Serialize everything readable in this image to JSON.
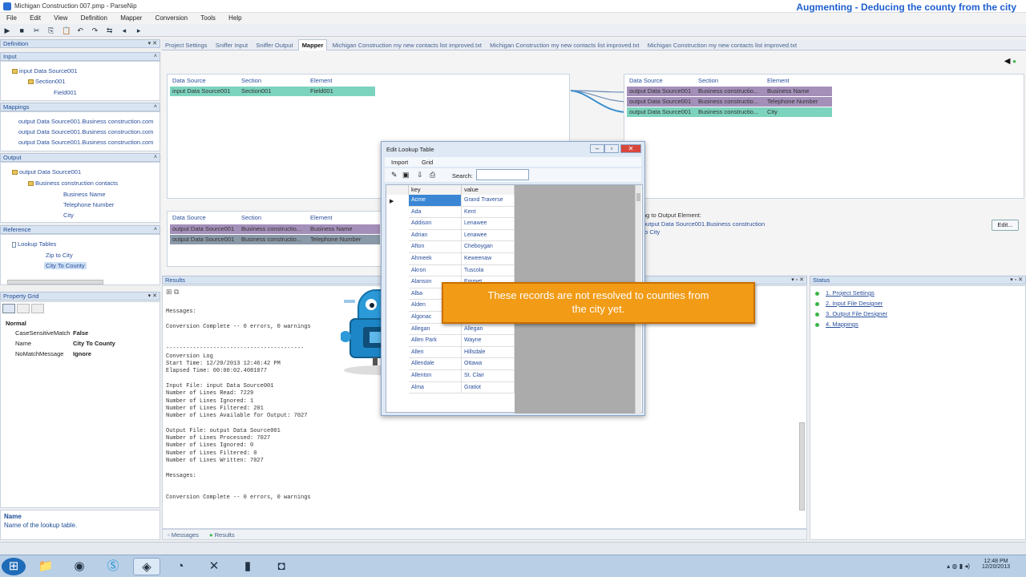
{
  "window": {
    "title": "Michigan Construction 007.pmp - ParseNip"
  },
  "overlay_title": "Augmenting - Deducing the county from the city",
  "menu": [
    "File",
    "Edit",
    "View",
    "Definition",
    "Mapper",
    "Conversion",
    "Tools",
    "Help"
  ],
  "left": {
    "definition_label": "Definition",
    "input_label": "Input",
    "input_tree": [
      "input Data Source001",
      "Section001",
      "Field001"
    ],
    "mappings_label": "Mappings",
    "mappings": [
      "output Data Source001.Business construction.com",
      "output Data Source001.Business construction.com",
      "output Data Source001.Business construction.com"
    ],
    "output_label": "Output",
    "output_tree": [
      "output Data Source001",
      "Business construction contacts",
      "Business Name",
      "Telephone Number",
      "City"
    ],
    "reference_label": "Reference",
    "reference_tree": [
      "Lookup Tables",
      "Zip to City",
      "City To County"
    ],
    "property_grid_label": "Property Grid",
    "props": {
      "category": "Normal",
      "rows": [
        {
          "k": "CaseSensitiveMatch",
          "v": "False"
        },
        {
          "k": "Name",
          "v": "City To County"
        },
        {
          "k": "NoMatchMessage",
          "v": "Ignore"
        }
      ]
    },
    "desc_title": "Name",
    "desc_text": "Name of the lookup table."
  },
  "tabs": [
    "Project Settings",
    "Sniffer Input",
    "Sniffer Output",
    "Mapper",
    "Michigan Construction my new contacts list improved.txt",
    "Michigan Construction my new contacts list improved.txt",
    "Michigan Construction my new contacts list improved.txt"
  ],
  "mapper": {
    "headers": [
      "Data Source",
      "Section",
      "Element"
    ],
    "input_row": [
      "input Data Source001",
      "Section001",
      "Field001"
    ],
    "output_rows": [
      [
        "output Data Source001",
        "Business constructio...",
        "Business Name"
      ],
      [
        "output Data Source001",
        "Business constructio...",
        "Telephone Number"
      ],
      [
        "output Data Source001",
        "Business constructio...",
        "City"
      ]
    ],
    "lower_rows": [
      [
        "output Data Source001",
        "Business constructio...",
        "Business Name"
      ],
      [
        "output Data Source001",
        "Business constructio...",
        "Telephone Number"
      ]
    ],
    "mapping_text": [
      "ng to Output Element:",
      "output Data Source001.Business construction",
      "to City"
    ],
    "edit_button": "Edit..."
  },
  "results": {
    "label": "Results",
    "log": "Messages:\n\nConversion Complete -- 0 errors, 0 warnings\n\n\n-----------------------------------------\nConversion Log\nStart Time: 12/20/2013 12:46:42 PM\nElapsed Time: 00:00:02.4081077\n\nInput File: input Data Source001\nNumber of Lines Read: 7229\nNumber of Lines Ignored: 1\nNumber of Lines Filtered: 201\nNumber of Lines Available for Output: 7027\n\nOutput File: output Data Source001\nNumber of Lines Processed: 7027\nNumber of Lines Ignored: 0\nNumber of Lines Filtered: 0\nNumber of Lines Written: 7027\n\nMessages:\n\n\nConversion Complete -- 0 errors, 0 warnings",
    "bottom_tabs": [
      "Messages",
      "Results"
    ]
  },
  "status": {
    "label": "Status",
    "items": [
      "1. Project Settings",
      "2. Input File Designer",
      "3. Output File Designer",
      "4. Mappings"
    ]
  },
  "dialog": {
    "title": "Edit Lookup Table",
    "menu": [
      "Import",
      "Grid"
    ],
    "search_label": "Search:",
    "search_value": "",
    "columns": [
      "key",
      "value"
    ],
    "rows": [
      [
        "Acme",
        "Grand Traverse"
      ],
      [
        "Ada",
        "Kent"
      ],
      [
        "Addison",
        "Lenawee"
      ],
      [
        "Adrian",
        "Lenawee"
      ],
      [
        "Afton",
        "Cheboygan"
      ],
      [
        "Ahmeek",
        "Keweenaw"
      ],
      [
        "Akron",
        "Tuscola"
      ],
      [
        "Alanson",
        "Emmet"
      ],
      [
        "Alba",
        "Antrim"
      ],
      [
        "Alden",
        "Antrim"
      ],
      [
        "Algonac",
        "St. Clair"
      ],
      [
        "Allegan",
        "Allegan"
      ],
      [
        "Allen Park",
        "Wayne"
      ],
      [
        "Allen",
        "Hillsdale"
      ],
      [
        "Allendale",
        "Ottawa"
      ],
      [
        "Allenton",
        "St. Clair"
      ],
      [
        "Alma",
        "Gratiot"
      ]
    ]
  },
  "callout": [
    "These records are not resolved to counties from",
    "the city yet."
  ],
  "clock": {
    "time": "12:48 PM",
    "date": "12/20/2013"
  }
}
